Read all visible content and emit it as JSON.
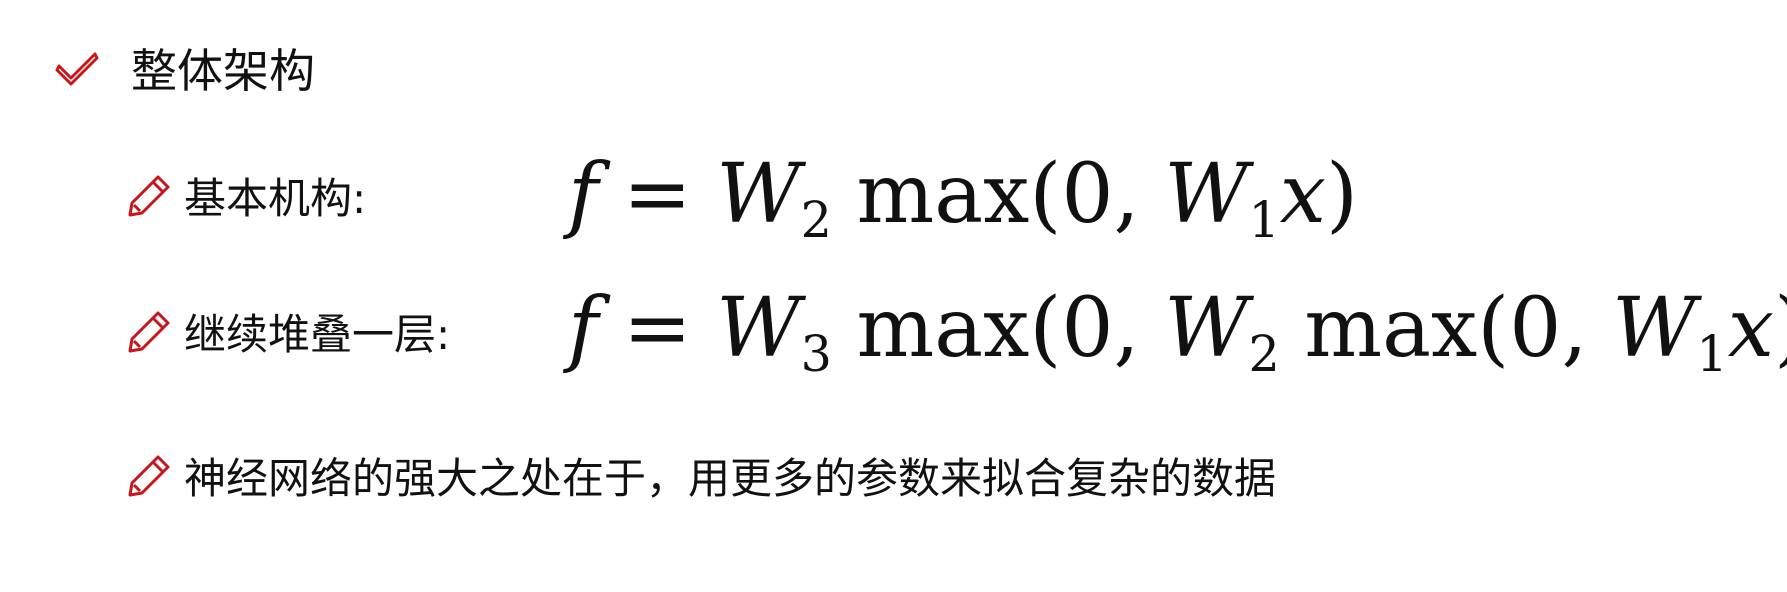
{
  "heading": {
    "icon": "check-icon",
    "text": "整体架构"
  },
  "items": [
    {
      "icon": "pencil-icon",
      "label": "基本机构:",
      "formula": {
        "f": "f",
        "eq": "=",
        "W_outer": "W",
        "W_outer_sub": "2",
        "max": "max",
        "open": "(",
        "zero": "0",
        "comma": ",",
        "W_inner": "W",
        "W_inner_sub": "1",
        "x": "x",
        "close": ")"
      }
    },
    {
      "icon": "pencil-icon",
      "label": "继续堆叠一层:",
      "formula": {
        "f": "f",
        "eq": "=",
        "W3": "W",
        "W3_sub": "3",
        "max1": "max",
        "open1": "(",
        "zero1": "0",
        "comma1": ",",
        "W2": "W",
        "W2_sub": "2",
        "max2": "max",
        "open2": "(",
        "zero2": "0",
        "comma2": ",",
        "W1": "W",
        "W1_sub": "1",
        "x": "x",
        "close": "))"
      }
    },
    {
      "icon": "pencil-icon",
      "label": "神经网络的强大之处在于，用更多的参数来拟合复杂的数据"
    }
  ],
  "colors": {
    "accent": "#c8161d",
    "text": "#111111"
  }
}
